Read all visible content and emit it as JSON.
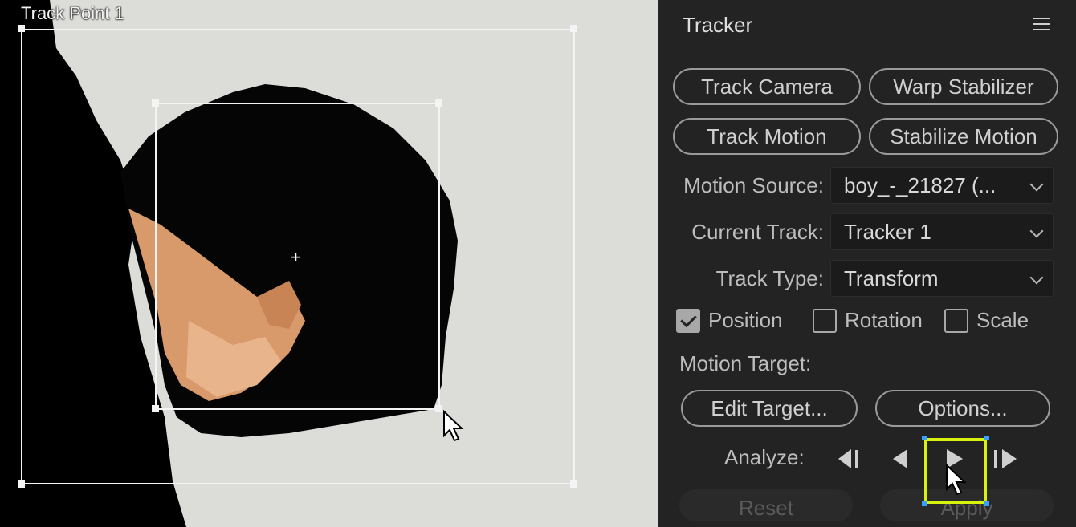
{
  "viewer": {
    "track_point_label": "Track Point 1"
  },
  "panel": {
    "title": "Tracker",
    "menu_icon": "hamburger-menu-icon",
    "buttons": {
      "track_camera": "Track Camera",
      "warp_stabilizer": "Warp Stabilizer",
      "track_motion": "Track Motion",
      "stabilize_motion": "Stabilize Motion"
    },
    "motion_source": {
      "label": "Motion Source:",
      "value": "boy_-_21827 (..."
    },
    "current_track": {
      "label": "Current Track:",
      "value": "Tracker 1"
    },
    "track_type": {
      "label": "Track Type:",
      "value": "Transform"
    },
    "checks": {
      "position": {
        "label": "Position",
        "checked": true
      },
      "rotation": {
        "label": "Rotation",
        "checked": false
      },
      "scale": {
        "label": "Scale",
        "checked": false
      }
    },
    "motion_target_label": "Motion Target:",
    "edit_target": "Edit Target...",
    "options": "Options...",
    "analyze_label": "Analyze:",
    "analyze_icons": [
      "analyze-backward-one-frame-icon",
      "analyze-backward-icon",
      "analyze-forward-icon",
      "analyze-forward-one-frame-icon"
    ],
    "reset": "Reset",
    "apply": "Apply"
  },
  "colors": {
    "panel_bg": "#232323",
    "highlight": "#d7f20d",
    "selection_handle": "#3aa0ff"
  }
}
